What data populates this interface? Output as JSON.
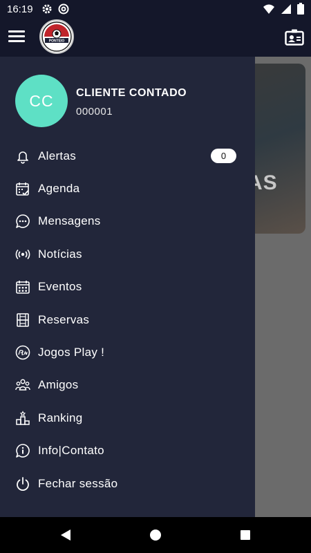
{
  "status_bar": {
    "time": "16:19",
    "icons": [
      "gear-icon",
      "at-sign-icon",
      "wifi-icon",
      "signal-icon",
      "battery-icon"
    ]
  },
  "app_bar": {
    "menu_icon": "hamburger-icon",
    "logo_text": "PONTEIO",
    "right_icon": "contact-card-icon"
  },
  "background": {
    "promo_partial_text": "AS"
  },
  "drawer": {
    "user": {
      "initials": "CC",
      "name": "CLIENTE CONTADO",
      "id": "000001",
      "avatar_color": "#5ee0c5"
    },
    "items": [
      {
        "label": "Alertas",
        "icon": "bell-icon",
        "badge": "0"
      },
      {
        "label": "Agenda",
        "icon": "calendar-check-icon"
      },
      {
        "label": "Mensagens",
        "icon": "chat-bubble-icon"
      },
      {
        "label": "Notícias",
        "icon": "broadcast-icon"
      },
      {
        "label": "Eventos",
        "icon": "calendar-grid-icon"
      },
      {
        "label": "Reservas",
        "icon": "court-icon"
      },
      {
        "label": "Jogos Play !",
        "icon": "play-badge-icon"
      },
      {
        "label": "Amigos",
        "icon": "friends-icon"
      },
      {
        "label": "Ranking",
        "icon": "podium-icon"
      },
      {
        "label": "Info|Contato",
        "icon": "info-icon"
      },
      {
        "label": "Fechar sessão",
        "icon": "power-icon"
      }
    ]
  },
  "nav_bar": {
    "icons": [
      "back-triangle-icon",
      "home-circle-icon",
      "recents-square-icon"
    ]
  },
  "colors": {
    "drawer_bg": "#22263a",
    "header_bg": "#14172a",
    "accent": "#5ee0c5"
  }
}
